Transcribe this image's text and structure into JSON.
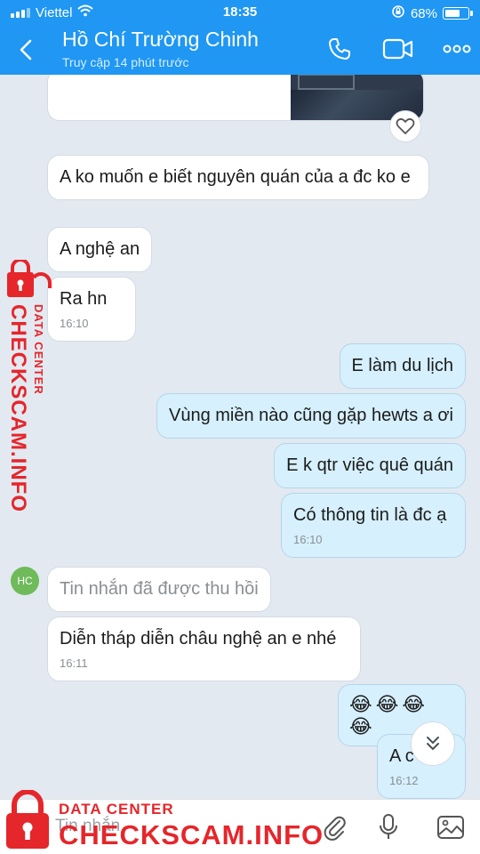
{
  "status_bar": {
    "carrier": "Viettel",
    "time": "18:35",
    "battery": "68%",
    "battery_level": 0.68
  },
  "header": {
    "name": "Hồ Chí Trường Chinh",
    "last_seen": "Truy cập 14 phút trước"
  },
  "messages": [
    {
      "text": "A ko muốn e biết nguyên quán của a đc ko e",
      "time": ""
    },
    {
      "text": "A nghệ an",
      "time": ""
    },
    {
      "text": "Ra hn",
      "time": "16:10"
    },
    {
      "text": "E làm du lịch",
      "time": ""
    },
    {
      "text": "Vùng miền nào cũng gặp hewts a ơi",
      "time": ""
    },
    {
      "text": "E k qtr việc quê quán",
      "time": ""
    },
    {
      "text": "Có thông tin là đc ạ",
      "time": "16:10"
    },
    {
      "text": "Tin nhắn đã được thu hồi",
      "time": ""
    },
    {
      "text": "Diễn tháp diễn châu nghệ an e nhé",
      "time": "16:11"
    },
    {
      "text": "😂😂😂😂",
      "time": ""
    },
    {
      "text": "A c",
      "time": "16:12"
    }
  ],
  "avatar_initials": "HC",
  "input": {
    "placeholder": "Tin nhắn"
  },
  "watermark": {
    "small": "DATA CENTER",
    "big": "CHECKSCAM.INFO"
  },
  "colors": {
    "header": "#1f97f3",
    "outgoing_bubble": "#d6f0fd",
    "chat_bg": "#e2e9f1",
    "watermark": "#e5262b"
  }
}
